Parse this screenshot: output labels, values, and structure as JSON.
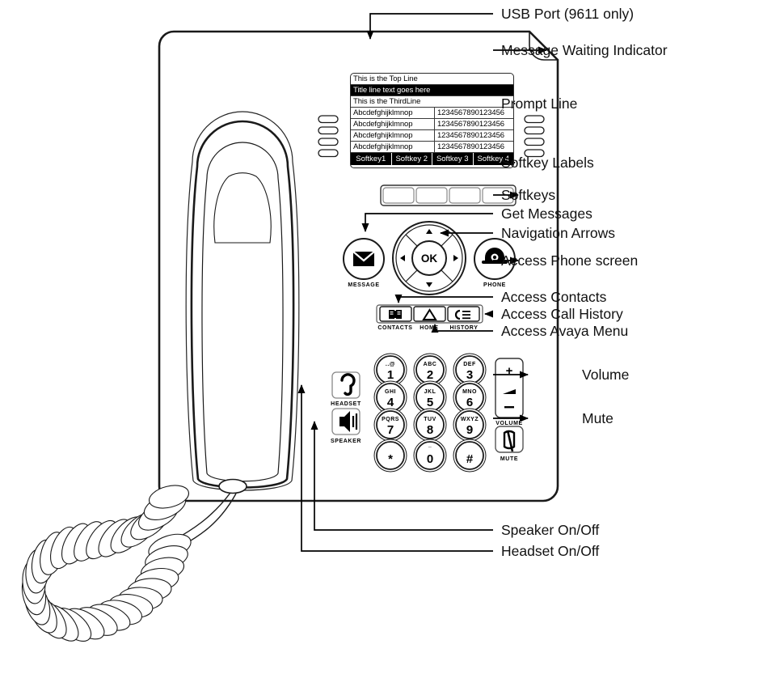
{
  "diagram": {
    "title": "Avaya 9611 deskphone feature callout diagram",
    "device_model": "9611"
  },
  "callouts": [
    {
      "id": "usb-port",
      "label": "USB Port (9611 only)"
    },
    {
      "id": "message-waiting",
      "label": "Message Waiting Indicator"
    },
    {
      "id": "prompt-line",
      "label": "Prompt Line"
    },
    {
      "id": "softkey-labels",
      "label": "Softkey Labels"
    },
    {
      "id": "softkeys",
      "label": "Softkeys"
    },
    {
      "id": "get-messages",
      "label": "Get Messages"
    },
    {
      "id": "navigation-arrows",
      "label": "Navigation Arrows"
    },
    {
      "id": "access-phone-screen",
      "label": "Access Phone screen"
    },
    {
      "id": "access-contacts",
      "label": "Access Contacts"
    },
    {
      "id": "access-call-history",
      "label": "Access Call History"
    },
    {
      "id": "access-avaya-menu",
      "label": "Access Avaya Menu"
    },
    {
      "id": "volume",
      "label": "Volume"
    },
    {
      "id": "mute",
      "label": "Mute"
    },
    {
      "id": "speaker-on-off",
      "label": "Speaker On/Off"
    },
    {
      "id": "headset-on-off",
      "label": "Headset On/Off"
    }
  ],
  "screen": {
    "top_line": "This is the Top Line",
    "title_line": "Title line text goes here",
    "third_line": "This is the ThirdLine",
    "call_rows": [
      {
        "left": "Abcdefghijklmnop",
        "right": "1234567890123456"
      },
      {
        "left": "Abcdefghijklmnop",
        "right": "1234567890123456"
      },
      {
        "left": "Abcdefghijklmnop",
        "right": "1234567890123456"
      },
      {
        "left": "Abcdefghijklmnop",
        "right": "1234567890123456"
      }
    ],
    "softkeys": [
      "Softkey1",
      "Softkey 2",
      "Softkey 3",
      "Softkey 4"
    ]
  },
  "keypad": [
    {
      "digit": "1",
      "letters": "..@"
    },
    {
      "digit": "2",
      "letters": "ABC"
    },
    {
      "digit": "3",
      "letters": "DEF"
    },
    {
      "digit": "4",
      "letters": "GHI"
    },
    {
      "digit": "5",
      "letters": "JKL"
    },
    {
      "digit": "6",
      "letters": "MNO"
    },
    {
      "digit": "7",
      "letters": "PQRS"
    },
    {
      "digit": "8",
      "letters": "TUV"
    },
    {
      "digit": "9",
      "letters": "WXYZ"
    },
    {
      "digit": "*",
      "letters": ""
    },
    {
      "digit": "0",
      "letters": "¯"
    },
    {
      "digit": "#",
      "letters": ""
    }
  ],
  "button_captions": {
    "message": "MESSAGE",
    "phone": "PHONE",
    "contacts": "CONTACTS",
    "home": "HOME",
    "history": "HISTORY",
    "headset": "HEADSET",
    "speaker": "SPEAKER",
    "volume": "VOLUME",
    "mute": "MUTE",
    "ok": "OK",
    "volume_up": "+",
    "volume_down": "–"
  },
  "colors": {
    "ink": "#000000",
    "paper": "#ffffff",
    "lcd_border": "#2b2b2b",
    "invert_bg": "#000000",
    "body_stroke": "#1a1a1a"
  }
}
